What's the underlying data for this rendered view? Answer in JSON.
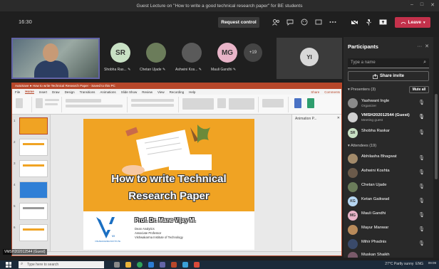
{
  "window": {
    "title": "Guest Lecture on \"How to write a good technical research paper\" for BE students",
    "controls": [
      "–",
      "□",
      "✕"
    ]
  },
  "toolbar": {
    "timer": "16:30",
    "request_control": "Request control",
    "leave": "Leave"
  },
  "video": {
    "tiles": [
      {
        "initials": "SR",
        "name": "Shobha Ras...",
        "color": "#c8e0c4"
      },
      {
        "initials": "",
        "name": "Chetan Ujade",
        "color": "#6b7c5a"
      },
      {
        "initials": "",
        "name": "Ashwini Kos...",
        "color": "#5a5a5a"
      },
      {
        "initials": "MG",
        "name": "Mauli Gandhi",
        "color": "#e8b4c8"
      }
    ],
    "more": "+19",
    "pinned_initials": "YI"
  },
  "ppt": {
    "title_bar": "AutoSave  ●  How to write Technical Research Paper  -  Saved to this PC",
    "tabs": [
      "File",
      "Home",
      "Insert",
      "Draw",
      "Design",
      "Transitions",
      "Animations",
      "Slide Show",
      "Review",
      "View",
      "Recording",
      "Help"
    ],
    "active_tab": "Home",
    "share_btn": "Share",
    "comments_btn": "Comments",
    "animation_pane": "Animation P...",
    "thumb_numbers": [
      "1",
      "2",
      "3",
      "4",
      "5",
      "6"
    ]
  },
  "slide": {
    "title_line1": "How to write Technical",
    "title_line2": "Research Paper",
    "presenter": "Prof. Dr. Mane Vijay M.",
    "role1": "Dean Analytics",
    "role2": "Associate Professor",
    "institute": "Vishwakarma Institute of Technology",
    "logo_text": "VISHWAKARMA INSTITUTE",
    "logo_vi": "VI"
  },
  "share_label": "VMSH202012544 (Guest)",
  "participants": {
    "title": "Participants",
    "search_placeholder": "Type a name",
    "share_invite": "Share invite",
    "mute_all": "Mute all",
    "presenters_header": "Presenters (3)",
    "attendees_header": "Attendees (19)",
    "presenters": [
      {
        "name": "Yashwant Ingle",
        "role": "Organizer",
        "initials": "",
        "color": "#8a8a8a"
      },
      {
        "name": "VMSH202012544 (Guest)",
        "role": "Meeting guest",
        "initials": "",
        "color": "#d0d0d0"
      },
      {
        "name": "Shobha Raskar",
        "role": "",
        "initials": "SR",
        "color": "#c8e0c4"
      }
    ],
    "attendees": [
      {
        "name": "Abhilasha Bhagwat",
        "initials": "",
        "color": "#a38b6b"
      },
      {
        "name": "Ashwini Koshta",
        "initials": "",
        "color": "#6b5a4a"
      },
      {
        "name": "Chetan Ujade",
        "initials": "",
        "color": "#6b7c5a"
      },
      {
        "name": "Ketan Gaikwad",
        "initials": "KG",
        "color": "#b6d6f2"
      },
      {
        "name": "Mauli Gandhi",
        "initials": "MG",
        "color": "#e8b4c8"
      },
      {
        "name": "Mayur Manwar",
        "initials": "",
        "color": "#b88a5a"
      },
      {
        "name": "Mihir Phadnis",
        "initials": "",
        "color": "#3a4a6a"
      },
      {
        "name": "Muskan Shaikh",
        "initials": "",
        "color": "#7a5a6a"
      }
    ]
  },
  "taskbar": {
    "search_placeholder": "Type here to search",
    "weather": "27°C  Partly sunny",
    "time": "09:09",
    "lang": "ENG"
  }
}
